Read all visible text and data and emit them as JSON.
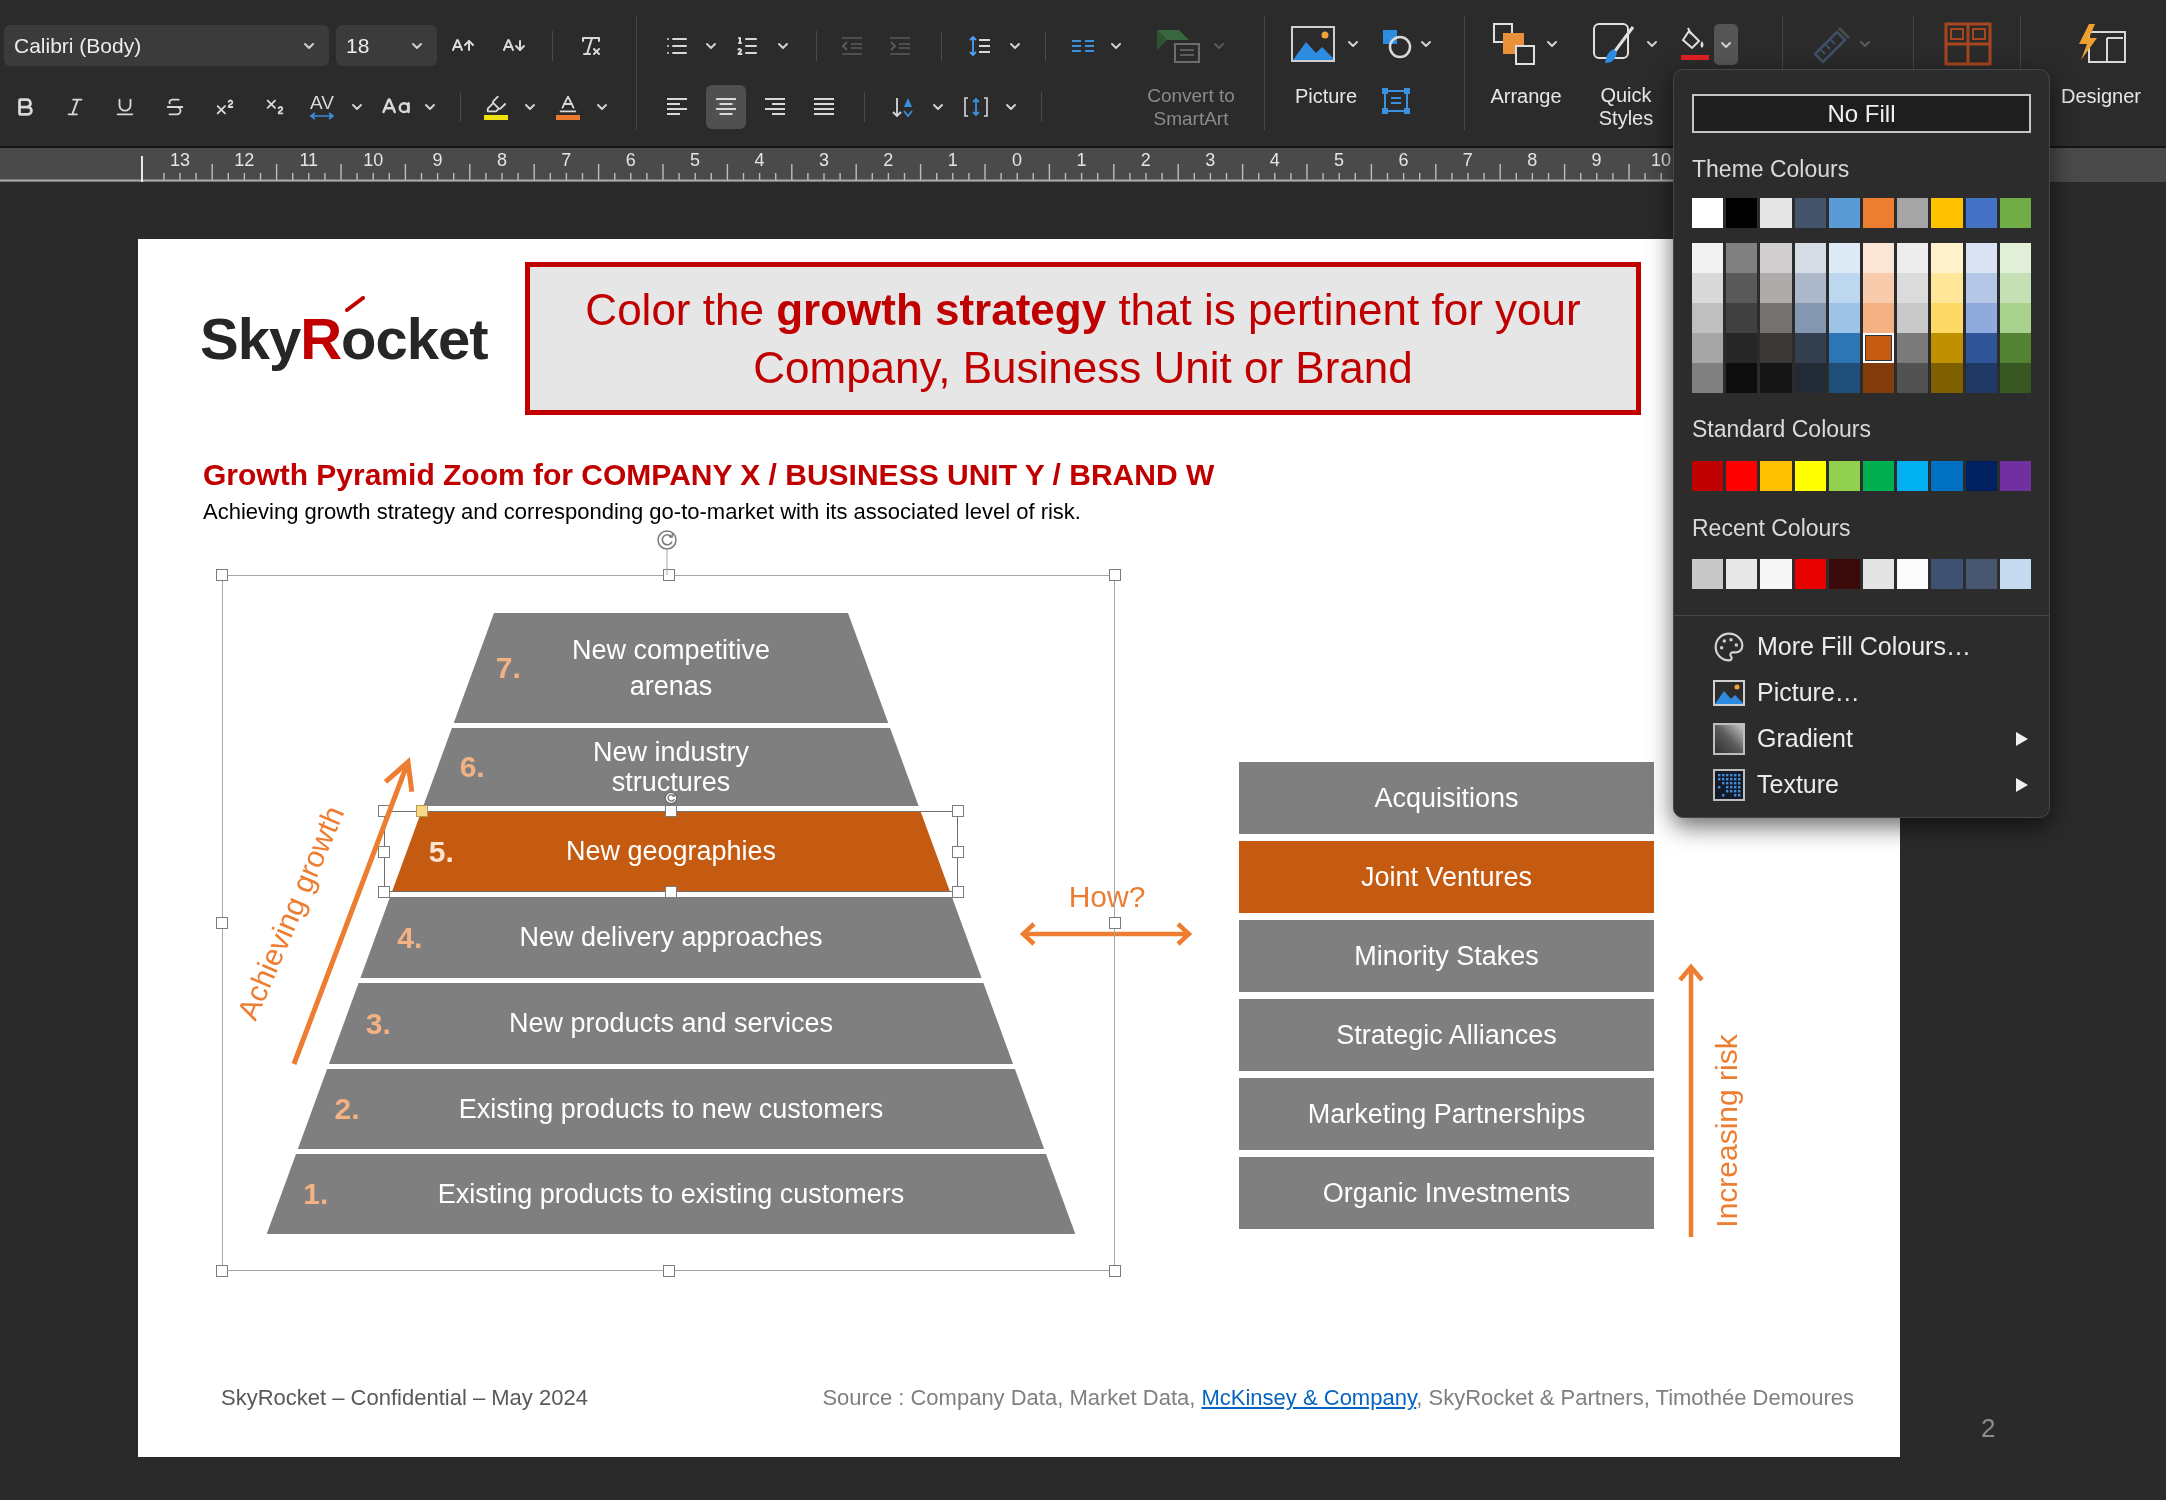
{
  "toolbar": {
    "font_name": "Calibri (Body)",
    "font_size": "18",
    "character_spacing": "AV",
    "indent_buttons": [
      {
        "kind": "decrease",
        "disabled": true
      },
      {
        "kind": "increase",
        "disabled": true
      }
    ],
    "alignment": [
      {
        "kind": "left",
        "selected": false
      },
      {
        "kind": "center",
        "selected": true
      },
      {
        "kind": "right",
        "selected": false
      },
      {
        "kind": "justify",
        "selected": false
      }
    ],
    "smartart": {
      "label": "Convert to SmartArt",
      "disabled": true
    },
    "picture": {
      "label": "Picture"
    },
    "arrange": {
      "label": "Arrange"
    },
    "quick_styles": {
      "label": "Quick Styles"
    },
    "shape_fill": {
      "expanded": true
    },
    "greyed_tool": {
      "disabled": true
    },
    "designer": {
      "label": "Designer"
    }
  },
  "ruler": {
    "labels": [
      "13",
      "12",
      "11",
      "10",
      "9",
      "8",
      "7",
      "6",
      "5",
      "4",
      "3",
      "2",
      "1",
      "0",
      "1",
      "2",
      "3",
      "4",
      "5",
      "6",
      "7",
      "8",
      "9",
      "10"
    ]
  },
  "slide": {
    "logo": {
      "parts": [
        {
          "text": "Sky",
          "color": "#262626"
        },
        {
          "text": "R",
          "color": "#c00000"
        },
        {
          "text": "ocket",
          "color": "#262626"
        }
      ]
    },
    "callout": "Color the **growth strategy** that is pertinent for your Company, Business Unit or Brand",
    "title": "Growth Pyramid Zoom for COMPANY X / BUSINESS UNIT Y / BRAND W",
    "subtitle": "Achieving growth strategy and corresponding go-to-market with its associated level of risk.",
    "pyramid": {
      "selected": true,
      "layers": [
        {
          "number": "7.",
          "label": "New competitive arenas",
          "highlighted": false,
          "selected": false
        },
        {
          "number": "6.",
          "label": "New industry structures",
          "highlighted": false,
          "selected": false
        },
        {
          "number": "5.",
          "label": "New geographies",
          "highlighted": true,
          "selected": true
        },
        {
          "number": "4.",
          "label": "New delivery approaches",
          "highlighted": false,
          "selected": false
        },
        {
          "number": "3.",
          "label": "New products and services",
          "highlighted": false,
          "selected": false
        },
        {
          "number": "2.",
          "label": "Existing products to new customers",
          "highlighted": false,
          "selected": false
        },
        {
          "number": "1.",
          "label": "Existing products to existing customers",
          "highlighted": false,
          "selected": false
        }
      ]
    },
    "growth_arrow": {
      "label": "Achieving growth"
    },
    "how_arrow": {
      "label": "How?"
    },
    "options": [
      {
        "label": "Acquisitions",
        "highlighted": false
      },
      {
        "label": "Joint Ventures",
        "highlighted": true
      },
      {
        "label": "Minority Stakes",
        "highlighted": false
      },
      {
        "label": "Strategic Alliances",
        "highlighted": false
      },
      {
        "label": "Marketing Partnerships",
        "highlighted": false
      },
      {
        "label": "Organic Investments",
        "highlighted": false
      }
    ],
    "risk_arrow": {
      "label": "Increasing risk"
    },
    "footer": "SkyRocket – Confidential – May 2024",
    "source": {
      "before": "Source : Company Data, Market Data, ",
      "link": "McKinsey & Company",
      "after": ", SkyRocket & Partners, Timothée Demoures"
    }
  },
  "page_number": "2",
  "fill_menu": {
    "no_fill": "No Fill",
    "theme_heading": "Theme Colours",
    "theme_colours": [
      {
        "color": "#ffffff",
        "selected": false
      },
      {
        "color": "#000000",
        "selected": false
      },
      {
        "color": "#e7e6e6",
        "selected": false
      },
      {
        "color": "#44546a",
        "selected": false
      },
      {
        "color": "#5b9bd5",
        "selected": false
      },
      {
        "color": "#ed7d31",
        "selected": false
      },
      {
        "color": "#a5a5a5",
        "selected": false
      },
      {
        "color": "#ffc000",
        "selected": false
      },
      {
        "color": "#4472c4",
        "selected": false
      },
      {
        "color": "#70ad47",
        "selected": false
      }
    ],
    "theme_shades": [
      {
        "swatches": [
          {
            "color": "#f2f2f2",
            "selected": false
          },
          {
            "color": "#808080",
            "selected": false
          },
          {
            "color": "#d0cece",
            "selected": false
          },
          {
            "color": "#d6dce4",
            "selected": false
          },
          {
            "color": "#deebf6",
            "selected": false
          },
          {
            "color": "#fbe5d5",
            "selected": false
          },
          {
            "color": "#ededed",
            "selected": false
          },
          {
            "color": "#fff2cc",
            "selected": false
          },
          {
            "color": "#dae3f3",
            "selected": false
          },
          {
            "color": "#e2f0d9",
            "selected": false
          }
        ]
      },
      {
        "swatches": [
          {
            "color": "#d9d9d9",
            "selected": false
          },
          {
            "color": "#595959",
            "selected": false
          },
          {
            "color": "#aeabab",
            "selected": false
          },
          {
            "color": "#adb9ca",
            "selected": false
          },
          {
            "color": "#bdd7ee",
            "selected": false
          },
          {
            "color": "#f8cbad",
            "selected": false
          },
          {
            "color": "#dbdbdb",
            "selected": false
          },
          {
            "color": "#ffe699",
            "selected": false
          },
          {
            "color": "#b4c7e7",
            "selected": false
          },
          {
            "color": "#c5e0b4",
            "selected": false
          }
        ]
      },
      {
        "swatches": [
          {
            "color": "#bfbfbf",
            "selected": false
          },
          {
            "color": "#404040",
            "selected": false
          },
          {
            "color": "#767171",
            "selected": false
          },
          {
            "color": "#8497b0",
            "selected": false
          },
          {
            "color": "#9dc3e6",
            "selected": false
          },
          {
            "color": "#f4b183",
            "selected": false
          },
          {
            "color": "#c9c9c9",
            "selected": false
          },
          {
            "color": "#ffd966",
            "selected": false
          },
          {
            "color": "#8faadc",
            "selected": false
          },
          {
            "color": "#a9d18e",
            "selected": false
          }
        ]
      },
      {
        "swatches": [
          {
            "color": "#a6a6a6",
            "selected": false
          },
          {
            "color": "#262626",
            "selected": false
          },
          {
            "color": "#3b3838",
            "selected": false
          },
          {
            "color": "#333f4f",
            "selected": false
          },
          {
            "color": "#2e75b5",
            "selected": false
          },
          {
            "color": "#c55a11",
            "selected": true
          },
          {
            "color": "#7b7b7b",
            "selected": false
          },
          {
            "color": "#bf9000",
            "selected": false
          },
          {
            "color": "#2f5597",
            "selected": false
          },
          {
            "color": "#548235",
            "selected": false
          }
        ]
      },
      {
        "swatches": [
          {
            "color": "#808080",
            "selected": false
          },
          {
            "color": "#0d0d0d",
            "selected": false
          },
          {
            "color": "#171616",
            "selected": false
          },
          {
            "color": "#222a35",
            "selected": false
          },
          {
            "color": "#1f4e79",
            "selected": false
          },
          {
            "color": "#833c0b",
            "selected": false
          },
          {
            "color": "#525252",
            "selected": false
          },
          {
            "color": "#7f6000",
            "selected": false
          },
          {
            "color": "#203864",
            "selected": false
          },
          {
            "color": "#385723",
            "selected": false
          }
        ]
      }
    ],
    "standard_heading": "Standard Colours",
    "standard_colours": [
      {
        "color": "#c00000",
        "selected": false
      },
      {
        "color": "#ff0000",
        "selected": false
      },
      {
        "color": "#ffc000",
        "selected": false
      },
      {
        "color": "#ffff00",
        "selected": false
      },
      {
        "color": "#92d050",
        "selected": false
      },
      {
        "color": "#00b050",
        "selected": false
      },
      {
        "color": "#00b0f0",
        "selected": false
      },
      {
        "color": "#0070c0",
        "selected": false
      },
      {
        "color": "#002060",
        "selected": false
      },
      {
        "color": "#7030a0",
        "selected": false
      }
    ],
    "recent_heading": "Recent Colours",
    "recent_colours": [
      {
        "color": "#c8c8c8",
        "selected": false
      },
      {
        "color": "#e8e8e8",
        "selected": false
      },
      {
        "color": "#f7f7f7",
        "selected": false
      },
      {
        "color": "#e60000",
        "selected": false
      },
      {
        "color": "#3a0a0a",
        "selected": false
      },
      {
        "color": "#e4e4e4",
        "selected": false
      },
      {
        "color": "#fbfbfb",
        "selected": false
      },
      {
        "color": "#3f5173",
        "selected": false
      },
      {
        "color": "#47566e",
        "selected": false
      },
      {
        "color": "#c5d9ef",
        "selected": false
      }
    ],
    "items": [
      {
        "kind": "palette",
        "label": "More Fill Colours…",
        "submenu": false
      },
      {
        "kind": "picture",
        "label": "Picture…",
        "submenu": false
      },
      {
        "kind": "gradient",
        "label": "Gradient",
        "submenu": true
      },
      {
        "kind": "texture",
        "label": "Texture",
        "submenu": true
      }
    ]
  }
}
